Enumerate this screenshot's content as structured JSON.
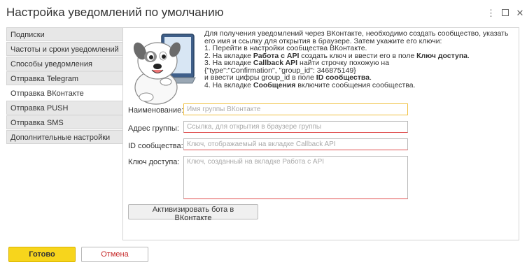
{
  "window": {
    "title": "Настройка уведомлений по умолчанию",
    "more_icon": "⋮",
    "close_icon": "✕"
  },
  "sidebar": {
    "items": [
      {
        "label": "Подписки"
      },
      {
        "label": "Частоты и сроки уведомлений"
      },
      {
        "label": "Способы уведомления"
      },
      {
        "label": "Отправка Telegram"
      },
      {
        "label": "Отправка ВКонтакте"
      },
      {
        "label": "Отправка PUSH"
      },
      {
        "label": "Отправка SMS"
      },
      {
        "label": "Дополнительные настройки"
      }
    ],
    "active_index": 4
  },
  "info": {
    "intro": "Для получения уведомлений через ВКонтакте, необходимо создать сообщество, указать его имя и ссылку для открытия в браузере. Затем укажите его ключи:",
    "step1": "1. Перейти в настройки сообщества ВКонтакте.",
    "step2_pre": "2. На вкладке ",
    "step2_b1": "Работа с API",
    "step2_mid": " создать ключ и ввести его в поле ",
    "step2_b2": "Ключ доступа",
    "step2_post": ".",
    "step3_pre": "3. На вкладке ",
    "step3_b1": "Callback API",
    "step3_post": " найти строчку похожую на",
    "step3_json": "{\"type\":\"Confirmation\", \"group_id\": 346875149}",
    "step3_l3_pre": "и ввести цифры group_id в поле ",
    "step3_l3_b": "ID сообщества",
    "step3_l3_post": ".",
    "step4_pre": "4. На вкладке ",
    "step4_b": "Сообщения",
    "step4_post": " включите сообщения сообщества."
  },
  "form": {
    "name_label": "Наименование:",
    "name_placeholder": "Имя группы ВКонтакте",
    "name_value": "",
    "address_label": "Адрес группы:",
    "address_placeholder": "Ссылка, для открытия в браузере группы",
    "address_value": "",
    "id_label": "ID сообщества:",
    "id_placeholder": "Ключ, отображаемый на вкладке Callback API",
    "id_value": "",
    "key_label": "Ключ доступа:",
    "key_placeholder": "Ключ, созданный на вкладке Работа с API",
    "key_value": ""
  },
  "buttons": {
    "activate": "Активизировать бота в ВКонтакте",
    "ok": "Готово",
    "cancel": "Отмена"
  },
  "colors": {
    "accent_yellow": "#f7d51c",
    "cancel_red": "#c62828",
    "required_red": "#e05050",
    "focus_yellow": "#f0c040"
  }
}
